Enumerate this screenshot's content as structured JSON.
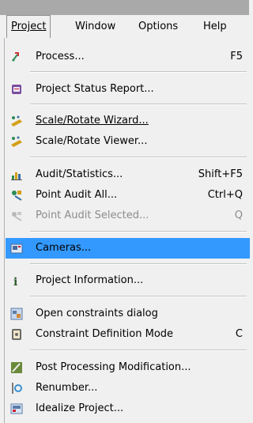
{
  "menubar": {
    "items": [
      {
        "label": "Project",
        "mnemonic_index": 0
      },
      {
        "label": "Window",
        "mnemonic_index": 0
      },
      {
        "label": "Options",
        "mnemonic_index": 0
      },
      {
        "label": "Help",
        "mnemonic_index": 0
      }
    ]
  },
  "menu": {
    "items": [
      {
        "label": "Process...",
        "shortcut": "F5",
        "icon": "process-icon",
        "state": "enabled"
      },
      {
        "label": "Project Status Report...",
        "shortcut": "",
        "icon": "report-icon",
        "state": "enabled"
      },
      {
        "label": "Scale/Rotate Wizard...",
        "shortcut": "",
        "icon": "scale-wizard-icon",
        "state": "enabled"
      },
      {
        "label": "Scale/Rotate Viewer...",
        "shortcut": "",
        "icon": "scale-viewer-icon",
        "state": "enabled"
      },
      {
        "label": "Audit/Statistics...",
        "shortcut": "Shift+F5",
        "icon": "audit-icon",
        "state": "enabled"
      },
      {
        "label": "Point Audit All...",
        "shortcut": "Ctrl+Q",
        "icon": "point-audit-icon",
        "state": "enabled"
      },
      {
        "label": "Point Audit Selected...",
        "shortcut": "Q",
        "icon": "point-audit-selected-icon",
        "state": "disabled"
      },
      {
        "label": "Cameras...",
        "shortcut": "",
        "icon": "camera-icon",
        "state": "highlighted"
      },
      {
        "label": "Project Information...",
        "shortcut": "",
        "icon": "info-icon",
        "state": "enabled"
      },
      {
        "label": "Open constraints dialog",
        "shortcut": "",
        "icon": "constraints-icon",
        "state": "enabled"
      },
      {
        "label": "Constraint Definition Mode",
        "shortcut": "C",
        "icon": "constraint-mode-icon",
        "state": "enabled"
      },
      {
        "label": "Post Processing Modification...",
        "shortcut": "",
        "icon": "post-processing-icon",
        "state": "enabled"
      },
      {
        "label": "Renumber...",
        "shortcut": "",
        "icon": "renumber-icon",
        "state": "enabled"
      },
      {
        "label": "Idealize Project...",
        "shortcut": "",
        "icon": "idealize-icon",
        "state": "enabled"
      }
    ]
  },
  "colors": {
    "highlight": "#3399ff",
    "menu_bg": "#f0f0f0",
    "disabled_text": "#8c8c8c"
  }
}
